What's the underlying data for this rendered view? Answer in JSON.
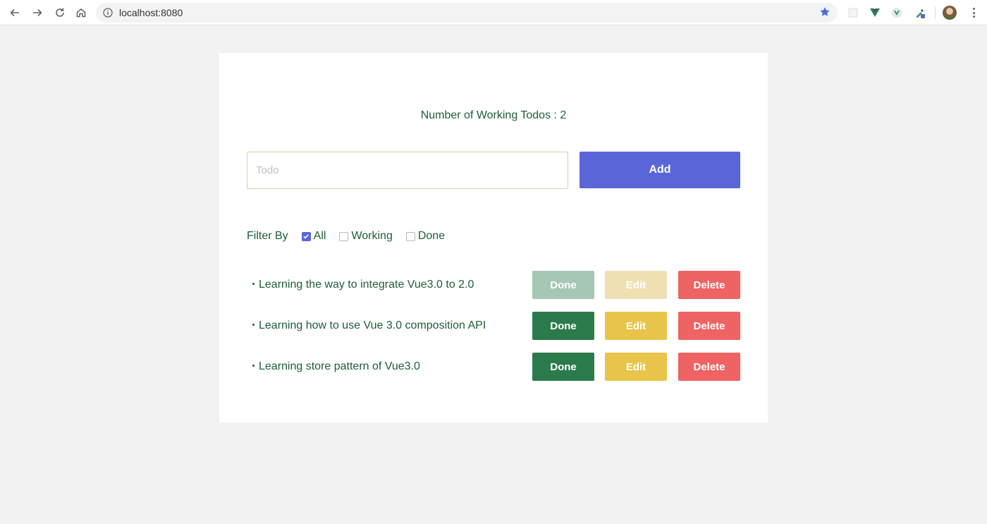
{
  "browser": {
    "url": "localhost:8080"
  },
  "app": {
    "counter_label": "Number of Working Todos : ",
    "counter_value": "2",
    "input_placeholder": "Todo",
    "input_value": "",
    "add_label": "Add",
    "filter": {
      "label": "Filter By",
      "options": [
        {
          "label": "All",
          "checked": true
        },
        {
          "label": "Working",
          "checked": false
        },
        {
          "label": "Done",
          "checked": false
        }
      ]
    },
    "todos": [
      {
        "text": "Learning the way to integrate Vue3.0 to 2.0",
        "done": true,
        "done_label": "Done",
        "edit_label": "Edit",
        "delete_label": "Delete"
      },
      {
        "text": "Learning how to use Vue 3.0 composition API",
        "done": false,
        "done_label": "Done",
        "edit_label": "Edit",
        "delete_label": "Delete"
      },
      {
        "text": "Learning store pattern of Vue3.0",
        "done": false,
        "done_label": "Done",
        "edit_label": "Edit",
        "delete_label": "Delete"
      }
    ]
  },
  "colors": {
    "accent": "#5a66d8",
    "text_green": "#1e5e36",
    "done_button": "#2b7a4b",
    "edit_button": "#e8c54a",
    "delete_button": "#ee6363"
  }
}
